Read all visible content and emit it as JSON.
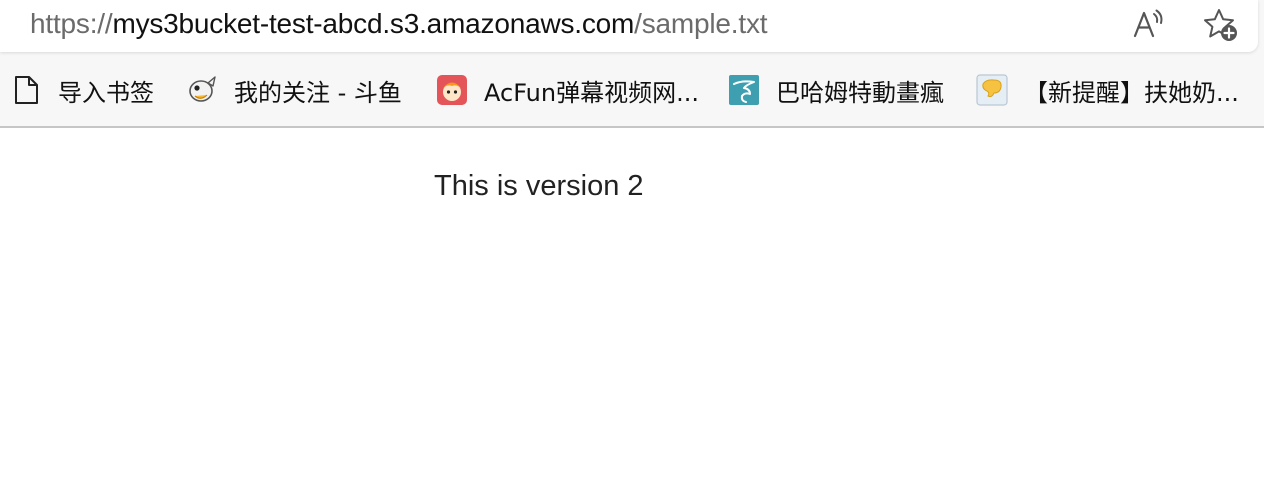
{
  "address_bar": {
    "scheme": "https://",
    "host": "mys3bucket-test-abcd.s3.amazonaws.com",
    "path": "/sample.txt",
    "read_aloud_icon": "read-aloud-icon",
    "add_favorite_icon": "add-favorite-icon"
  },
  "bookmarks": [
    {
      "label": "导入书签",
      "icon": "document-icon"
    },
    {
      "label": "我的关注 - 斗鱼",
      "icon": "douyu-fish-icon"
    },
    {
      "label": "AcFun弹幕视频网...",
      "icon": "acfun-icon"
    },
    {
      "label": "巴哈姆特動畫瘋",
      "icon": "bahamut-icon"
    },
    {
      "label": "【新提醒】扶她奶...",
      "icon": "forum-icon"
    }
  ],
  "page": {
    "text": "This is version 2"
  },
  "colors": {
    "url_dim": "#6b6b6b",
    "url_host": "#111111",
    "acfun_red": "#e4555a",
    "bahamut_teal": "#3d9fb0"
  }
}
